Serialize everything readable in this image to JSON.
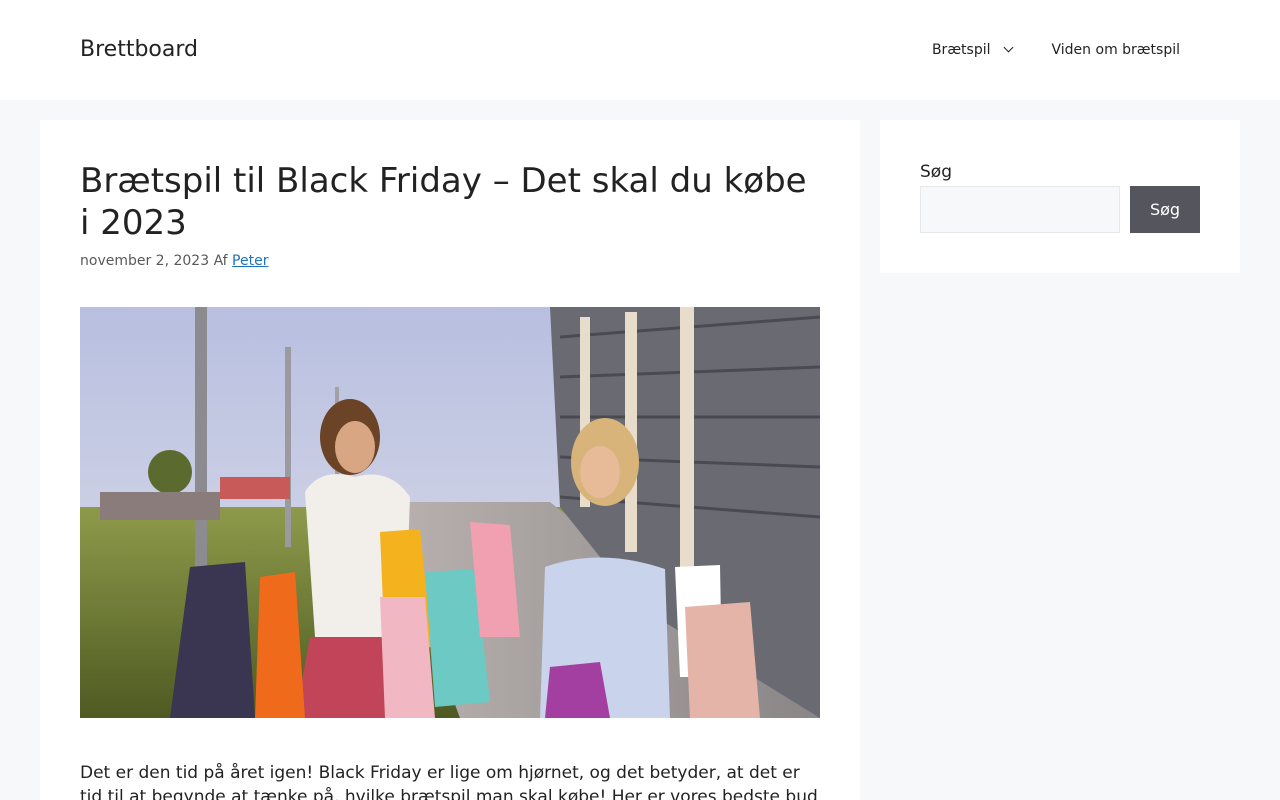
{
  "header": {
    "site_title": "Brettboard",
    "nav": [
      {
        "label": "Brætspil",
        "has_dropdown": true
      },
      {
        "label": "Viden om brætspil",
        "has_dropdown": false
      }
    ]
  },
  "article": {
    "title": "Brætspil til Black Friday – Det skal du købe i 2023",
    "date": "november 2, 2023",
    "author_prefix": "Af",
    "author": "Peter",
    "intro": "Det er den tid på året igen! Black Friday er lige om hjørnet, og det betyder, at det er tid til at begynde at tænke på, hvilke brætspil man skal købe! Her er vores bedste bud på, hvad du skal"
  },
  "sidebar": {
    "search_label": "Søg",
    "search_value": "",
    "search_button": "Søg"
  },
  "colors": {
    "link": "#1e73be",
    "button_bg": "#55555e",
    "page_bg": "#f7f8f9"
  }
}
